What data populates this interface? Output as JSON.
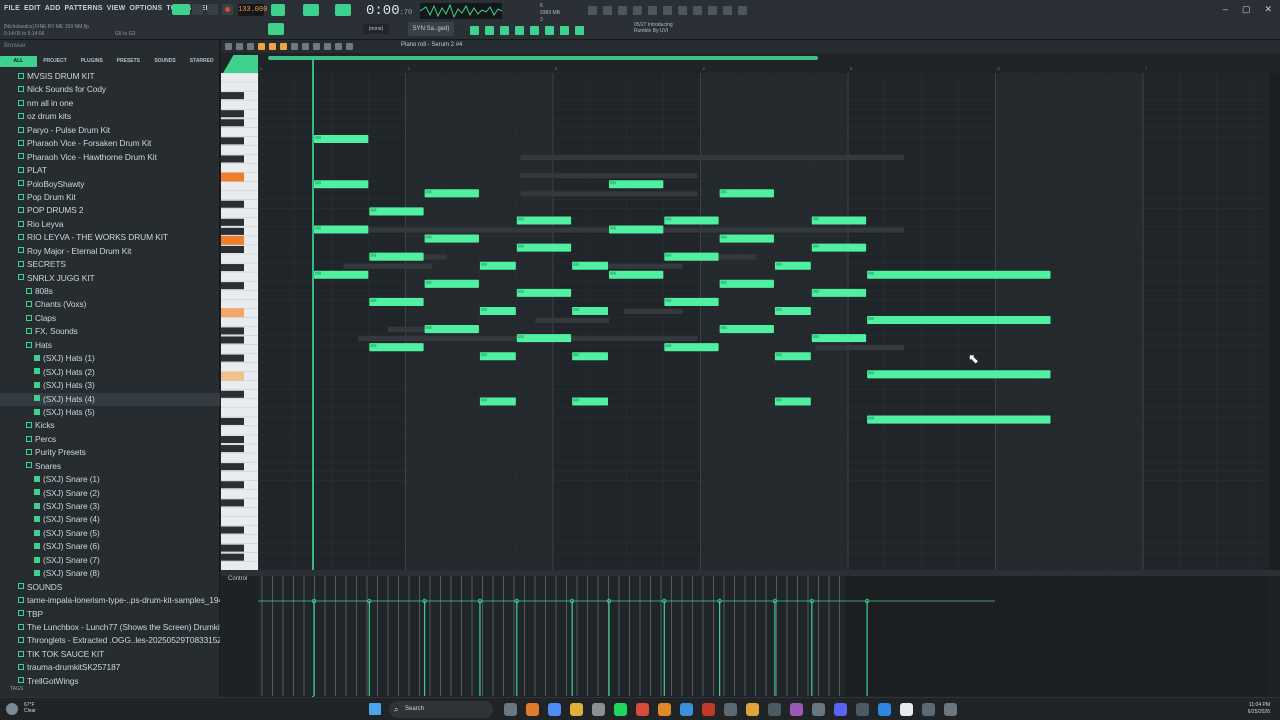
{
  "menu": [
    "FILE",
    "EDIT",
    "ADD",
    "PATTERNS",
    "VIEW",
    "OPTIONS",
    "TOOLS",
    "HELP"
  ],
  "file": {
    "title": "[Nicholasdcx] FINE BY ME 159 NM.flp",
    "time_range": "5:14:05 to 5:14:06",
    "hint": "G5 to G3"
  },
  "transport": {
    "tempo": "133.000",
    "time": "0:00",
    "time_sub": ":70"
  },
  "cpu": {
    "line1": "6",
    "line2": "9389 MB",
    "line3": "3"
  },
  "news": {
    "line1": "05/27 Introducing",
    "line2": "Rumble By UVI"
  },
  "snap": "(none)",
  "instrument": "SYN Sa..ged)",
  "browser": {
    "title": "Browser",
    "tabs": [
      "ALL",
      "PROJECT",
      "PLUGINS",
      "PRESETS",
      "SOUNDS",
      "STARRED"
    ],
    "items": [
      {
        "label": "MVSIS DRUM KIT",
        "indent": 1,
        "type": "folder"
      },
      {
        "label": "Nick Sounds for Cody",
        "indent": 1,
        "type": "folder"
      },
      {
        "label": "nm all in one",
        "indent": 1,
        "type": "folder"
      },
      {
        "label": "oz drum kits",
        "indent": 1,
        "type": "folder"
      },
      {
        "label": "Paryo - Pulse Drum Kit",
        "indent": 1,
        "type": "folder"
      },
      {
        "label": "Pharaoh Vice - Forsaken Drum Kit",
        "indent": 1,
        "type": "folder"
      },
      {
        "label": "Pharaoh Vice - Hawthorne Drum Kit",
        "indent": 1,
        "type": "folder"
      },
      {
        "label": "PLAT",
        "indent": 1,
        "type": "folder"
      },
      {
        "label": "PoloBoyShawty",
        "indent": 1,
        "type": "folder"
      },
      {
        "label": "Pop Drum Kit",
        "indent": 1,
        "type": "folder"
      },
      {
        "label": "POP DRUMS 2",
        "indent": 1,
        "type": "folder"
      },
      {
        "label": "Rio Leyva",
        "indent": 1,
        "type": "folder"
      },
      {
        "label": "RIO LEYVA - THE WORKS DRUM KIT",
        "indent": 1,
        "type": "folder"
      },
      {
        "label": "Roy Major - Eternal Drum Kit",
        "indent": 1,
        "type": "folder"
      },
      {
        "label": "SECRETS",
        "indent": 1,
        "type": "folder"
      },
      {
        "label": "SNRLX JUGG KIT",
        "indent": 1,
        "type": "folder"
      },
      {
        "label": "808s",
        "indent": 2,
        "type": "folder"
      },
      {
        "label": "Chants (Voxs)",
        "indent": 2,
        "type": "folder"
      },
      {
        "label": "Claps",
        "indent": 2,
        "type": "folder"
      },
      {
        "label": "FX, Sounds",
        "indent": 2,
        "type": "folder"
      },
      {
        "label": "Hats",
        "indent": 2,
        "type": "folder"
      },
      {
        "label": "(SXJ) Hats (1)",
        "indent": 3,
        "type": "file"
      },
      {
        "label": "(SXJ) Hats (2)",
        "indent": 3,
        "type": "file"
      },
      {
        "label": "(SXJ) Hats (3)",
        "indent": 3,
        "type": "file"
      },
      {
        "label": "(SXJ) Hats (4)",
        "indent": 3,
        "type": "file",
        "selected": true
      },
      {
        "label": "(SXJ) Hats (5)",
        "indent": 3,
        "type": "file"
      },
      {
        "label": "Kicks",
        "indent": 2,
        "type": "folder"
      },
      {
        "label": "Percs",
        "indent": 2,
        "type": "folder"
      },
      {
        "label": "Purity Presets",
        "indent": 2,
        "type": "folder"
      },
      {
        "label": "Snares",
        "indent": 2,
        "type": "folder"
      },
      {
        "label": "(SXJ) Snare (1)",
        "indent": 3,
        "type": "file"
      },
      {
        "label": "(SXJ) Snare (2)",
        "indent": 3,
        "type": "file"
      },
      {
        "label": "(SXJ) Snare (3)",
        "indent": 3,
        "type": "file"
      },
      {
        "label": "(SXJ) Snare (4)",
        "indent": 3,
        "type": "file"
      },
      {
        "label": "(SXJ) Snare (5)",
        "indent": 3,
        "type": "file"
      },
      {
        "label": "(SXJ) Snare (6)",
        "indent": 3,
        "type": "file"
      },
      {
        "label": "(SXJ) Snare (7)",
        "indent": 3,
        "type": "file"
      },
      {
        "label": "(SXJ) Snare (8)",
        "indent": 3,
        "type": "file"
      },
      {
        "label": "SOUNDS",
        "indent": 1,
        "type": "folder"
      },
      {
        "label": "tame-impala-lonerism-type-..ps-drum-kit-samples_19481",
        "indent": 1,
        "type": "folder"
      },
      {
        "label": "TBP",
        "indent": 1,
        "type": "folder"
      },
      {
        "label": "The Lunchbox - Lunch77 (Shows the Screen) Drumkit",
        "indent": 1,
        "type": "folder"
      },
      {
        "label": "Thronglets - Extracted .OGG..les-20250529T083315Z-1-001",
        "indent": 1,
        "type": "folder"
      },
      {
        "label": "TIK TOK SAUCE KIT",
        "indent": 1,
        "type": "folder"
      },
      {
        "label": "trauma-drumkitSK257187",
        "indent": 1,
        "type": "folder"
      },
      {
        "label": "TrellGotWings",
        "indent": 1,
        "type": "folder"
      }
    ],
    "tags_label": "TAGS"
  },
  "piano_roll": {
    "title": "Piano roll - Serum 2 #4",
    "bar_numbers": [
      "1",
      "2",
      "3",
      "4",
      "5",
      "6",
      "7"
    ],
    "control_label": "Control",
    "notes": [
      {
        "start": 0.0,
        "len": 0.375,
        "pitch": 0
      },
      {
        "start": 0.0,
        "len": 0.375,
        "pitch": 5
      },
      {
        "start": 0.0,
        "len": 0.375,
        "pitch": 10
      },
      {
        "start": 0.0,
        "len": 0.375,
        "pitch": 15
      },
      {
        "start": 0.375,
        "len": 0.375,
        "pitch": 8
      },
      {
        "start": 0.375,
        "len": 0.375,
        "pitch": 13
      },
      {
        "start": 0.375,
        "len": 0.375,
        "pitch": 18
      },
      {
        "start": 0.375,
        "len": 0.375,
        "pitch": 23
      },
      {
        "start": 0.75,
        "len": 0.375,
        "pitch": 6
      },
      {
        "start": 0.75,
        "len": 0.375,
        "pitch": 11
      },
      {
        "start": 0.75,
        "len": 0.375,
        "pitch": 16
      },
      {
        "start": 0.75,
        "len": 0.375,
        "pitch": 21
      },
      {
        "start": 1.125,
        "len": 0.25,
        "pitch": 14
      },
      {
        "start": 1.125,
        "len": 0.25,
        "pitch": 19
      },
      {
        "start": 1.125,
        "len": 0.25,
        "pitch": 24
      },
      {
        "start": 1.125,
        "len": 0.25,
        "pitch": 29
      },
      {
        "start": 1.375,
        "len": 0.375,
        "pitch": 9
      },
      {
        "start": 1.375,
        "len": 0.375,
        "pitch": 12
      },
      {
        "start": 1.375,
        "len": 0.375,
        "pitch": 17
      },
      {
        "start": 1.375,
        "len": 0.375,
        "pitch": 22
      },
      {
        "start": 1.75,
        "len": 0.25,
        "pitch": 14
      },
      {
        "start": 1.75,
        "len": 0.25,
        "pitch": 19
      },
      {
        "start": 1.75,
        "len": 0.25,
        "pitch": 24
      },
      {
        "start": 1.75,
        "len": 0.25,
        "pitch": 29
      },
      {
        "start": 2.0,
        "len": 0.375,
        "pitch": 5
      },
      {
        "start": 2.0,
        "len": 0.375,
        "pitch": 10
      },
      {
        "start": 2.0,
        "len": 0.375,
        "pitch": 15
      },
      {
        "start": 2.375,
        "len": 0.375,
        "pitch": 9
      },
      {
        "start": 2.375,
        "len": 0.375,
        "pitch": 13
      },
      {
        "start": 2.375,
        "len": 0.375,
        "pitch": 18
      },
      {
        "start": 2.375,
        "len": 0.375,
        "pitch": 23
      },
      {
        "start": 2.75,
        "len": 0.375,
        "pitch": 6
      },
      {
        "start": 2.75,
        "len": 0.375,
        "pitch": 11
      },
      {
        "start": 2.75,
        "len": 0.375,
        "pitch": 16
      },
      {
        "start": 2.75,
        "len": 0.375,
        "pitch": 21
      },
      {
        "start": 3.125,
        "len": 0.25,
        "pitch": 14
      },
      {
        "start": 3.125,
        "len": 0.25,
        "pitch": 19
      },
      {
        "start": 3.125,
        "len": 0.25,
        "pitch": 24
      },
      {
        "start": 3.125,
        "len": 0.25,
        "pitch": 29
      },
      {
        "start": 3.375,
        "len": 0.375,
        "pitch": 9
      },
      {
        "start": 3.375,
        "len": 0.375,
        "pitch": 12
      },
      {
        "start": 3.375,
        "len": 0.375,
        "pitch": 17
      },
      {
        "start": 3.375,
        "len": 0.375,
        "pitch": 22
      },
      {
        "start": 3.75,
        "len": 1.25,
        "pitch": 15
      },
      {
        "start": 3.75,
        "len": 1.25,
        "pitch": 20
      },
      {
        "start": 3.75,
        "len": 1.25,
        "pitch": 26
      },
      {
        "start": 3.75,
        "len": 1.25,
        "pitch": 31
      }
    ],
    "ghost_notes": [
      {
        "start": 0.5,
        "len": 0.5,
        "pitch": 21
      },
      {
        "start": 1.5,
        "len": 0.5,
        "pitch": 20
      },
      {
        "start": 2.1,
        "len": 0.4,
        "pitch": 19
      },
      {
        "start": 0.2,
        "len": 0.6,
        "pitch": 14
      },
      {
        "start": 0.7,
        "len": 0.2,
        "pitch": 13
      },
      {
        "start": 1.9,
        "len": 0.6,
        "pitch": 14
      },
      {
        "start": 2.6,
        "len": 0.4,
        "pitch": 13
      },
      {
        "start": 0.0,
        "len": 4.0,
        "pitch": 10
      },
      {
        "start": 1.4,
        "len": 1.2,
        "pitch": 6
      },
      {
        "start": 1.4,
        "len": 1.2,
        "pitch": 4
      },
      {
        "start": 1.4,
        "len": 2.6,
        "pitch": 2
      },
      {
        "start": 0.3,
        "len": 2.3,
        "pitch": 22
      },
      {
        "start": 3.4,
        "len": 0.6,
        "pitch": 23
      }
    ]
  },
  "taskbar": {
    "weather_temp": "67°F",
    "weather_desc": "Clear",
    "search": "Search",
    "time": "11:04 PM",
    "date": "6/25/2026"
  },
  "colors": {
    "note": "#4ff0a0",
    "accent": "#3fd18e",
    "grid_bg": "#22272b"
  }
}
